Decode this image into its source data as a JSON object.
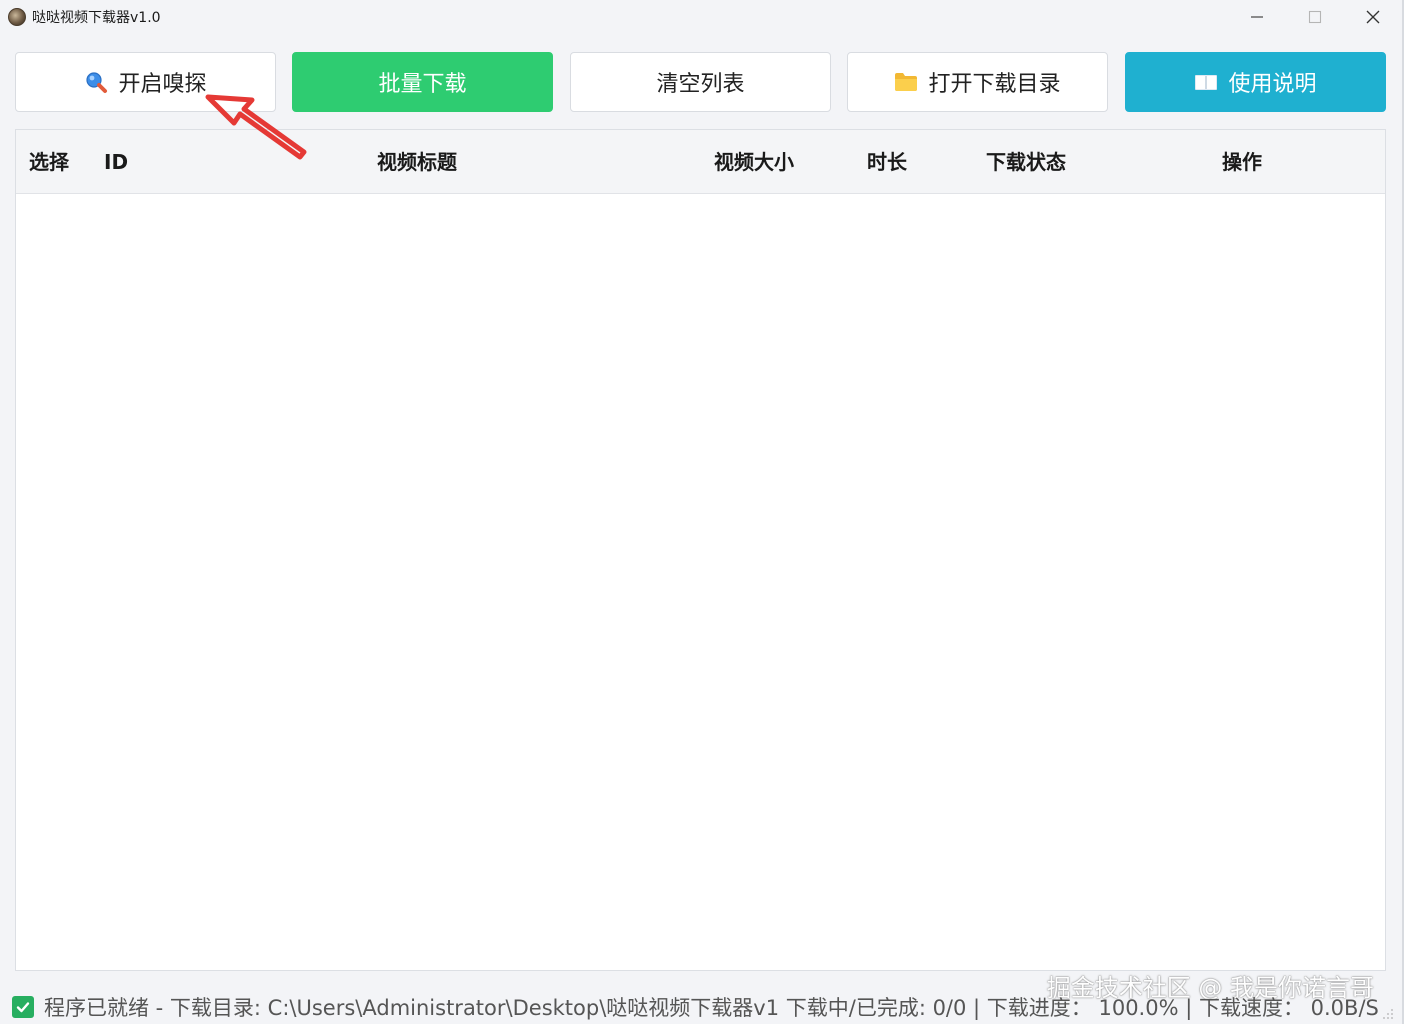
{
  "window": {
    "title": "哒哒视频下载器v1.0"
  },
  "toolbar": {
    "sniff_label": "开启嗅探",
    "batch_download_label": "批量下载",
    "clear_list_label": "清空列表",
    "open_dir_label": "打开下载目录",
    "usage_label": "使用说明"
  },
  "table": {
    "columns": [
      "选择",
      "ID",
      "视频标题",
      "视频大小",
      "时长",
      "下载状态",
      "操作"
    ],
    "rows": []
  },
  "status": {
    "text": "程序已就绪 - 下载目录: C:\\Users\\Administrator\\Desktop\\哒哒视频下载器v1 下载中/已完成: 0/0 | 下载进度： 100.0% | 下载速度： 0.0B/S"
  },
  "watermark": "掘金技术社区 @ 我是你诺言哥",
  "colors": {
    "green_button": "#2ecc71",
    "teal_button": "#1fb0d0",
    "annotation_arrow": "#e53935",
    "status_check": "#27ae60"
  },
  "icons": {
    "sniff": "magnifier-icon",
    "open_dir": "folder-icon",
    "usage": "book-icon"
  }
}
